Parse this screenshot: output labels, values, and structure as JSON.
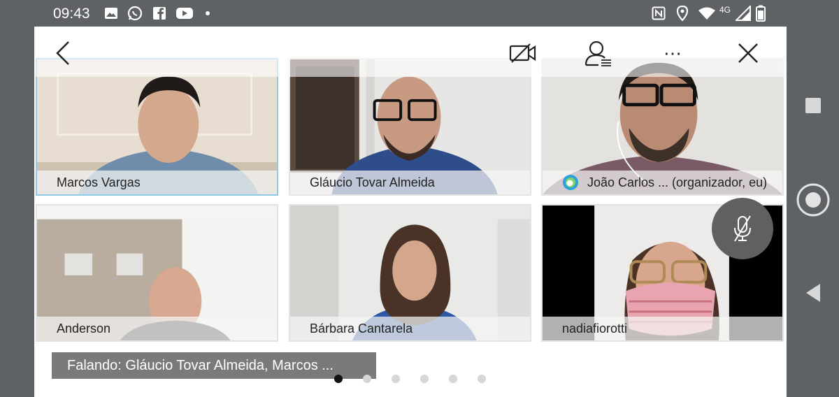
{
  "status_bar": {
    "time": "09:43",
    "left_icons": [
      "image-icon",
      "whatsapp-icon",
      "facebook-icon",
      "youtube-icon",
      "notification-dot-icon"
    ],
    "right_icons": [
      "nfc-icon",
      "location-icon",
      "wifi-icon",
      "signal-icon",
      "battery-icon"
    ],
    "network": "4G"
  },
  "toolbar": {
    "back_icon": "chevron-left-icon",
    "camera_icon": "camera-off-icon",
    "participants_icon": "participants-list-icon",
    "more_label": "⋯",
    "close_icon": "close-icon"
  },
  "participants": [
    {
      "name": "Marcos Vargas",
      "active": true
    },
    {
      "name": "Gláucio Tovar Almeida",
      "active": false
    },
    {
      "name": "João Carlos ... (organizador, eu)",
      "active": false
    },
    {
      "name": "Anderson",
      "active": false
    },
    {
      "name": "Bárbara Cantarela",
      "active": false
    },
    {
      "name": "nadiafiorotti",
      "active": false
    }
  ],
  "speaking_label": "Falando: Gláucio Tovar Almeida, Marcos ...",
  "pagination": {
    "pages": 6,
    "current": 1
  },
  "colors": {
    "active_border": "#8fc9e4",
    "speaking_bg": "#7a7a7a",
    "mute_button": "#5e6061",
    "webex_logo": "#2aa3d8"
  }
}
